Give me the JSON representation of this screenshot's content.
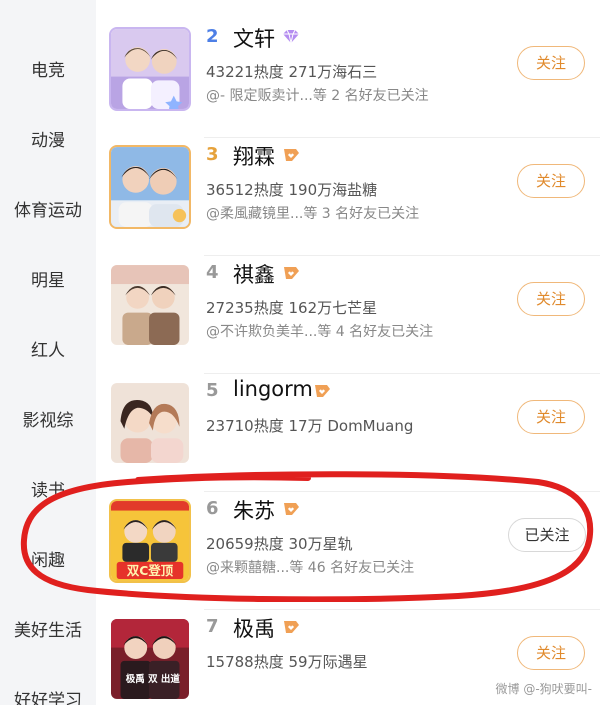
{
  "sidebar": {
    "items": [
      "电竞",
      "动漫",
      "体育运动",
      "明星",
      "红人",
      "影视综",
      "读书",
      "闲趣",
      "美好生活",
      "好好学习"
    ]
  },
  "rows": [
    {
      "rank": "2",
      "name": "文轩",
      "stats": "43221热度 271万海石三",
      "friends": "@- 限定贩卖计...等 2 名好友已关注",
      "follow": "关注",
      "rank_color": "#4d7fe6"
    },
    {
      "rank": "3",
      "name": "翔霖",
      "stats": "36512热度 190万海盐糖",
      "friends": "@柔風藏镜里...等 3 名好友已关注",
      "follow": "关注",
      "rank_color": "#e6a23c"
    },
    {
      "rank": "4",
      "name": "祺鑫",
      "stats": "27235热度 162万七芒星",
      "friends": "@不许欺负美羊...等 4 名好友已关注",
      "follow": "关注",
      "rank_color": "#999999"
    },
    {
      "rank": "5",
      "name": "lingorm",
      "stats": "23710热度 17万 DomMuang",
      "friends": "",
      "follow": "关注",
      "rank_color": "#999999"
    },
    {
      "rank": "6",
      "name": "朱苏",
      "stats": "20659热度 30万星轨",
      "friends": "@来颗囍糖...等 46 名好友已关注",
      "follow": "已关注",
      "rank_color": "#999999",
      "thumb_text": "双C登顶"
    },
    {
      "rank": "7",
      "name": "极禹",
      "stats": "15788热度 59万际遇星",
      "friends": "",
      "follow": "关注",
      "rank_color": "#999999",
      "thumb_text": "极禹 双 出道"
    }
  ],
  "annotation": {
    "color": "#e0201e"
  },
  "watermark": "微博 @-狗吠要叫-",
  "icons": {
    "badge": "heart-badge-icon",
    "diamond": "diamond-badge-icon"
  }
}
